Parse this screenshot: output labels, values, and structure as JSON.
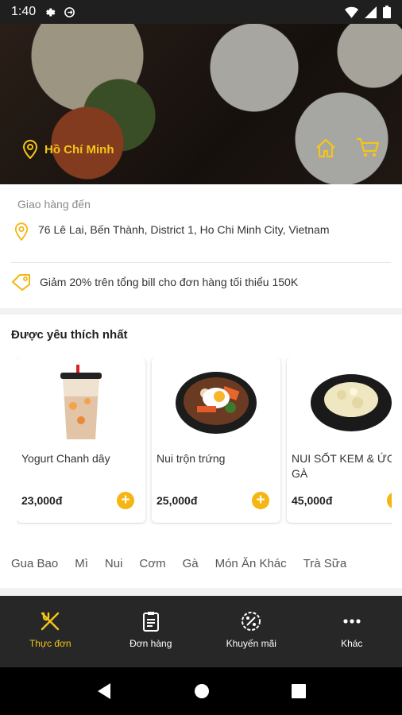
{
  "status_bar": {
    "time": "1:40"
  },
  "hero": {
    "location": "Hồ Chí Minh"
  },
  "delivery": {
    "label": "Giao hàng đến",
    "address": "76 Lê Lai, Bến Thành, District 1, Ho Chi Minh City, Vietnam",
    "promo": "Giảm 20% trên tổng bill cho đơn hàng tối thiểu 150K"
  },
  "popular": {
    "title": "Được yêu thích nhất",
    "products": [
      {
        "name": "Yogurt Chanh dây",
        "price": "23,000đ"
      },
      {
        "name": "Nui trộn trứng",
        "price": "25,000đ"
      },
      {
        "name": "NUI SỐT KEM & ỨC GÀ",
        "price": "45,000đ"
      }
    ],
    "categories": [
      "Gua Bao",
      "Mì",
      "Nui",
      "Cơm",
      "Gà",
      "Món Ăn Khác",
      "Trà Sữa"
    ]
  },
  "bottom_nav": [
    {
      "label": "Thực đơn",
      "icon": "fork-knife-icon"
    },
    {
      "label": "Đơn hàng",
      "icon": "clipboard-icon"
    },
    {
      "label": "Khuyến mãi",
      "icon": "discount-badge-icon"
    },
    {
      "label": "Khác",
      "icon": "more-dots-icon"
    }
  ],
  "colors": {
    "accent": "#f5c518",
    "nav_bg": "#272727"
  }
}
